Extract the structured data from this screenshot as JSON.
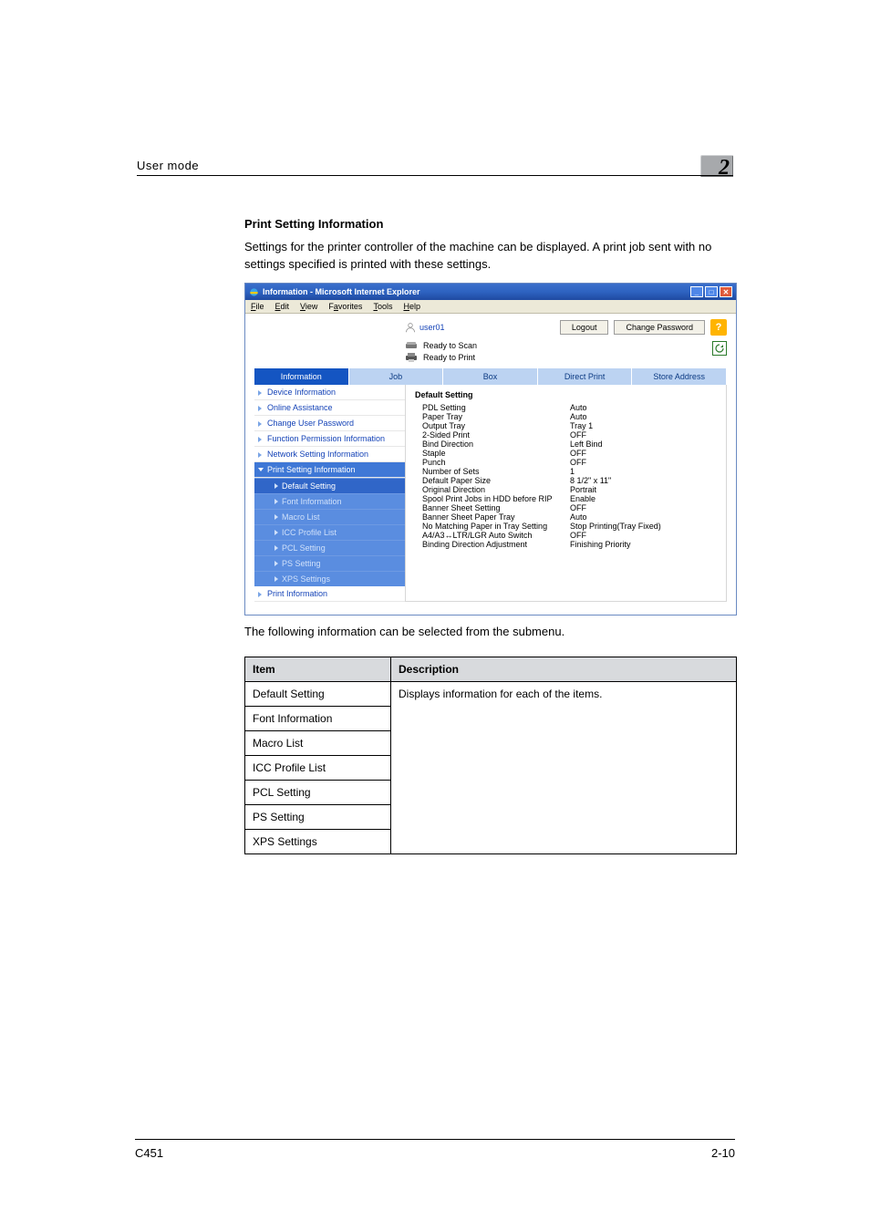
{
  "header": {
    "running": "User mode",
    "chapter": "2"
  },
  "section_title": "Print Setting Information",
  "section_body": "Settings for the printer controller of the machine can be displayed. A print job sent with no settings specified is printed with these settings.",
  "screenshot": {
    "window_title": "Information - Microsoft Internet Explorer",
    "menu": [
      {
        "prefix": "F",
        "rest": "ile"
      },
      {
        "prefix": "E",
        "rest": "dit"
      },
      {
        "prefix": "V",
        "rest": "iew"
      },
      {
        "prefix": "",
        "rest": "F",
        "tail": "avorites",
        "underline_index": 1
      },
      {
        "prefix": "T",
        "rest": "ools"
      },
      {
        "prefix": "H",
        "rest": "elp"
      }
    ],
    "user": "user01",
    "buttons": {
      "logout": "Logout",
      "change_password": "Change Password"
    },
    "help_icon": "?",
    "status": {
      "scan": "Ready to Scan",
      "print": "Ready to Print"
    },
    "tabs": {
      "information": "Information",
      "job": "Job",
      "box": "Box",
      "direct_print": "Direct Print",
      "store_address": "Store Address"
    },
    "sidebar": {
      "items": [
        "Device Information",
        "Online Assistance",
        "Change User Password",
        "Function Permission Information",
        "Network Setting Information",
        "Print Setting Information",
        "Print Information"
      ],
      "subs": [
        "Default Setting",
        "Font Information",
        "Macro List",
        "ICC Profile List",
        "PCL Setting",
        "PS Setting",
        "XPS Settings"
      ]
    },
    "main": {
      "title": "Default Setting",
      "rows": [
        {
          "k": "PDL Setting",
          "v": "Auto"
        },
        {
          "k": "Paper Tray",
          "v": "Auto"
        },
        {
          "k": "Output Tray",
          "v": "Tray 1"
        },
        {
          "k": "2-Sided Print",
          "v": "OFF"
        },
        {
          "k": "Bind Direction",
          "v": "Left Bind"
        },
        {
          "k": "Staple",
          "v": "OFF"
        },
        {
          "k": "Punch",
          "v": "OFF"
        },
        {
          "k": "Number of Sets",
          "v": "1"
        },
        {
          "k": "Default Paper Size",
          "v": "8 1/2\" x 11\""
        },
        {
          "k": "Original Direction",
          "v": "Portrait"
        },
        {
          "k": "Spool Print Jobs in HDD before RIP",
          "v": "Enable"
        },
        {
          "k": "Banner Sheet Setting",
          "v": "OFF"
        },
        {
          "k": "Banner Sheet Paper Tray",
          "v": "Auto"
        },
        {
          "k": "No Matching Paper in Tray Setting",
          "v": "Stop Printing(Tray Fixed)"
        },
        {
          "k": "A4/A3↔LTR/LGR Auto Switch",
          "v": "OFF"
        },
        {
          "k": "Binding Direction Adjustment",
          "v": "Finishing Priority"
        }
      ]
    }
  },
  "intro2": "The following information can be selected from the submenu.",
  "table": {
    "head": {
      "c1": "Item",
      "c2": "Description"
    },
    "rows": [
      {
        "item": "Default Setting",
        "desc": "Displays information for each of the items."
      },
      {
        "item": "Font Information",
        "desc": ""
      },
      {
        "item": "Macro List",
        "desc": ""
      },
      {
        "item": "ICC Profile List",
        "desc": ""
      },
      {
        "item": "PCL Setting",
        "desc": ""
      },
      {
        "item": "PS Setting",
        "desc": ""
      },
      {
        "item": "XPS Settings",
        "desc": ""
      }
    ]
  },
  "footer": {
    "left": "C451",
    "right": "2-10"
  }
}
